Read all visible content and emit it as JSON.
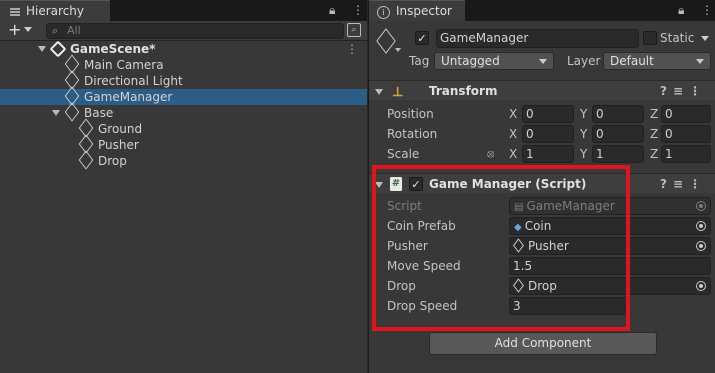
{
  "hierarchy": {
    "tab_label": "Hierarchy",
    "add_button": "+",
    "search_placeholder": "All",
    "scene": {
      "name": "GameScene*"
    },
    "items": [
      {
        "label": "Main Camera"
      },
      {
        "label": "Directional Light"
      },
      {
        "label": "GameManager",
        "selected": true
      },
      {
        "label": "Base"
      },
      {
        "label": "Ground"
      },
      {
        "label": "Pusher"
      },
      {
        "label": "Drop"
      }
    ]
  },
  "inspector": {
    "tab_label": "Inspector",
    "object": {
      "name": "GameManager",
      "active": true,
      "static_label": "Static",
      "static": false
    },
    "tag": {
      "label": "Tag",
      "value": "Untagged"
    },
    "layer": {
      "label": "Layer",
      "value": "Default"
    },
    "transform": {
      "title": "Transform",
      "rows": [
        {
          "label": "Position",
          "x": "0",
          "y": "0",
          "z": "0"
        },
        {
          "label": "Rotation",
          "x": "0",
          "y": "0",
          "z": "0"
        },
        {
          "label": "Scale",
          "x": "1",
          "y": "1",
          "z": "1"
        }
      ],
      "axis_x": "X",
      "axis_y": "Y",
      "axis_z": "Z"
    },
    "script_component": {
      "title": "Game Manager (Script)",
      "enabled": true,
      "fields": [
        {
          "label": "Script",
          "value": "GameManager",
          "type": "object",
          "disabled": true
        },
        {
          "label": "Coin Prefab",
          "value": "Coin",
          "type": "object"
        },
        {
          "label": "Pusher",
          "value": "Pusher",
          "type": "object"
        },
        {
          "label": "Move Speed",
          "value": "1.5",
          "type": "number"
        },
        {
          "label": "Drop",
          "value": "Drop",
          "type": "object"
        },
        {
          "label": "Drop Speed",
          "value": "3",
          "type": "number"
        }
      ]
    },
    "add_component_label": "Add Component"
  },
  "colors": {
    "selection": "#2c5d87",
    "highlight_box": "#e0141e",
    "panel_bg": "#383838"
  }
}
